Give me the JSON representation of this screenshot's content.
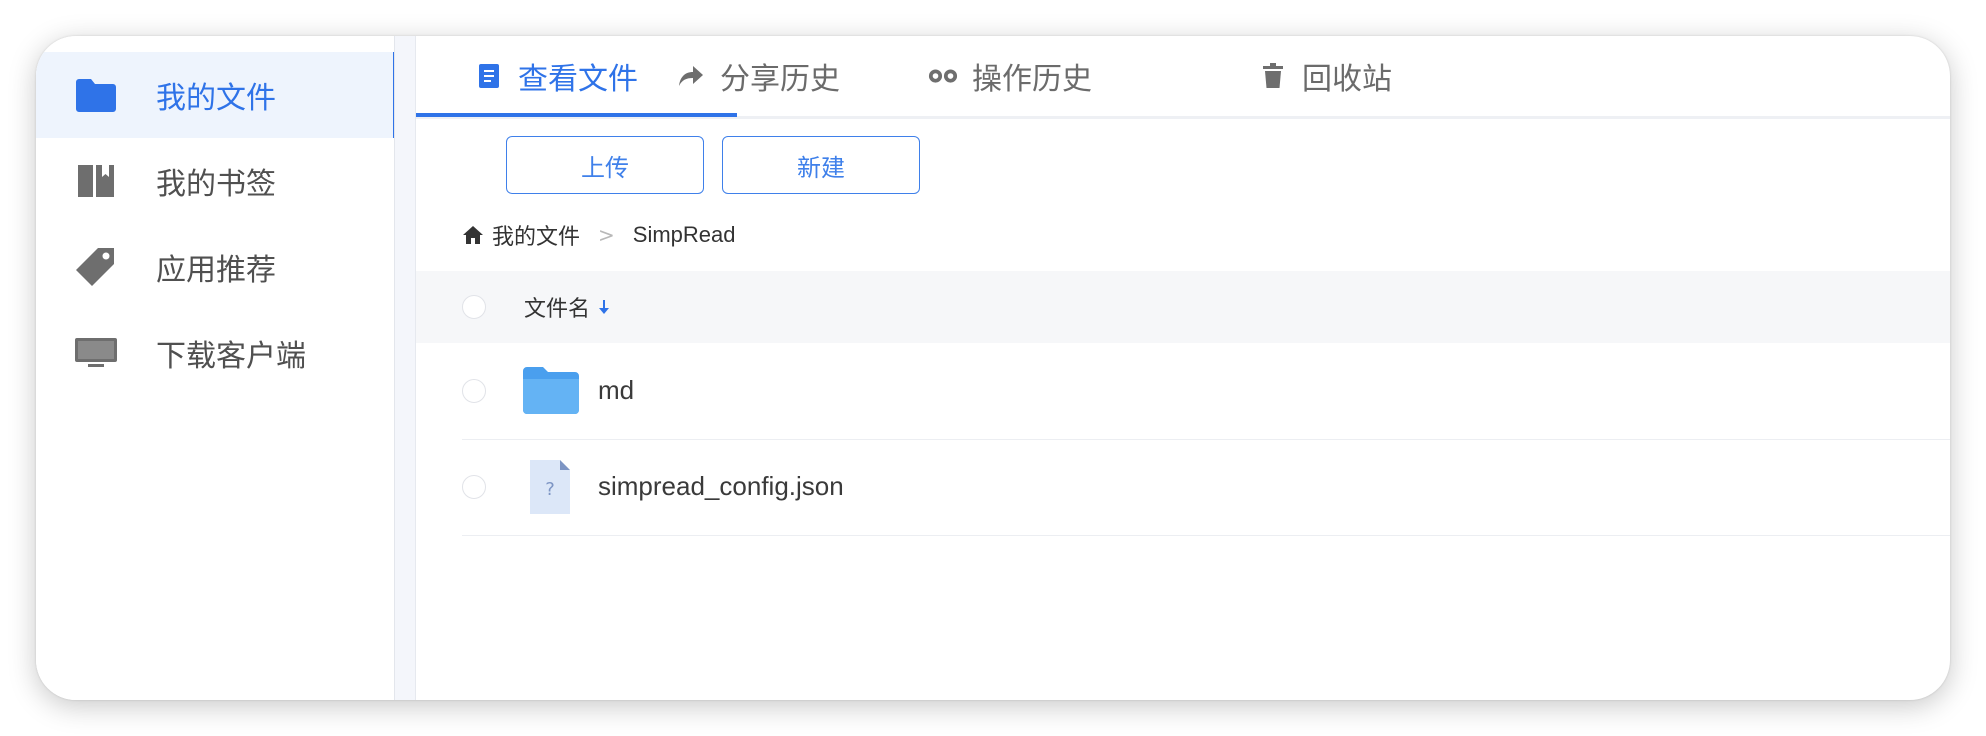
{
  "sidebar": {
    "items": [
      {
        "label": "我的文件",
        "icon": "folder-icon",
        "active": true
      },
      {
        "label": "我的书签",
        "icon": "bookmark-book-icon",
        "active": false
      },
      {
        "label": "应用推荐",
        "icon": "tag-icon",
        "active": false
      },
      {
        "label": "下载客户端",
        "icon": "monitor-icon",
        "active": false
      }
    ]
  },
  "tabs": [
    {
      "label": "查看文件",
      "icon": "document-icon",
      "active": true
    },
    {
      "label": "分享历史",
      "icon": "share-arrow-icon",
      "active": false
    },
    {
      "label": "操作历史",
      "icon": "history-eyes-icon",
      "active": false
    },
    {
      "label": "回收站",
      "icon": "trash-icon",
      "active": false
    }
  ],
  "toolbar": {
    "upload_label": "上传",
    "new_label": "新建"
  },
  "breadcrumb": {
    "home_icon": "home-icon",
    "items": [
      "我的文件",
      "SimpRead"
    ],
    "separator": ">"
  },
  "table": {
    "header_name": "文件名",
    "sort_icon": "sort-down-arrow-icon",
    "rows": [
      {
        "name": "md",
        "type": "folder"
      },
      {
        "name": "simpread_config.json",
        "type": "unknown-file"
      }
    ]
  },
  "colors": {
    "accent": "#2f73e8",
    "active_bg": "#eef4fd",
    "folder": "#5aa9f0"
  }
}
